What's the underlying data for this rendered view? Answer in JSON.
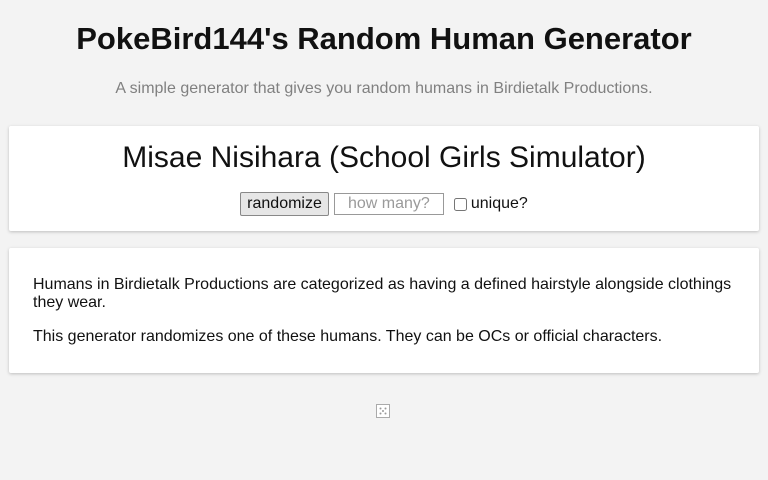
{
  "header": {
    "title": "PokeBird144's Random Human Generator",
    "subtitle": "A simple generator that gives you random humans in Birdietalk Productions."
  },
  "generator": {
    "result": "Misae Nisihara (School Girls Simulator)",
    "randomize_label": "randomize",
    "count_placeholder": "how many?",
    "count_value": "",
    "unique_label": "unique?",
    "unique_checked": false
  },
  "info": {
    "paragraphs": [
      "Humans in Birdietalk Productions are categorized as having a defined hairstyle alongside clothings they wear.",
      "This generator randomizes one of these humans. They can be OCs or official characters."
    ]
  },
  "footer": {
    "icon": "dice-icon"
  }
}
